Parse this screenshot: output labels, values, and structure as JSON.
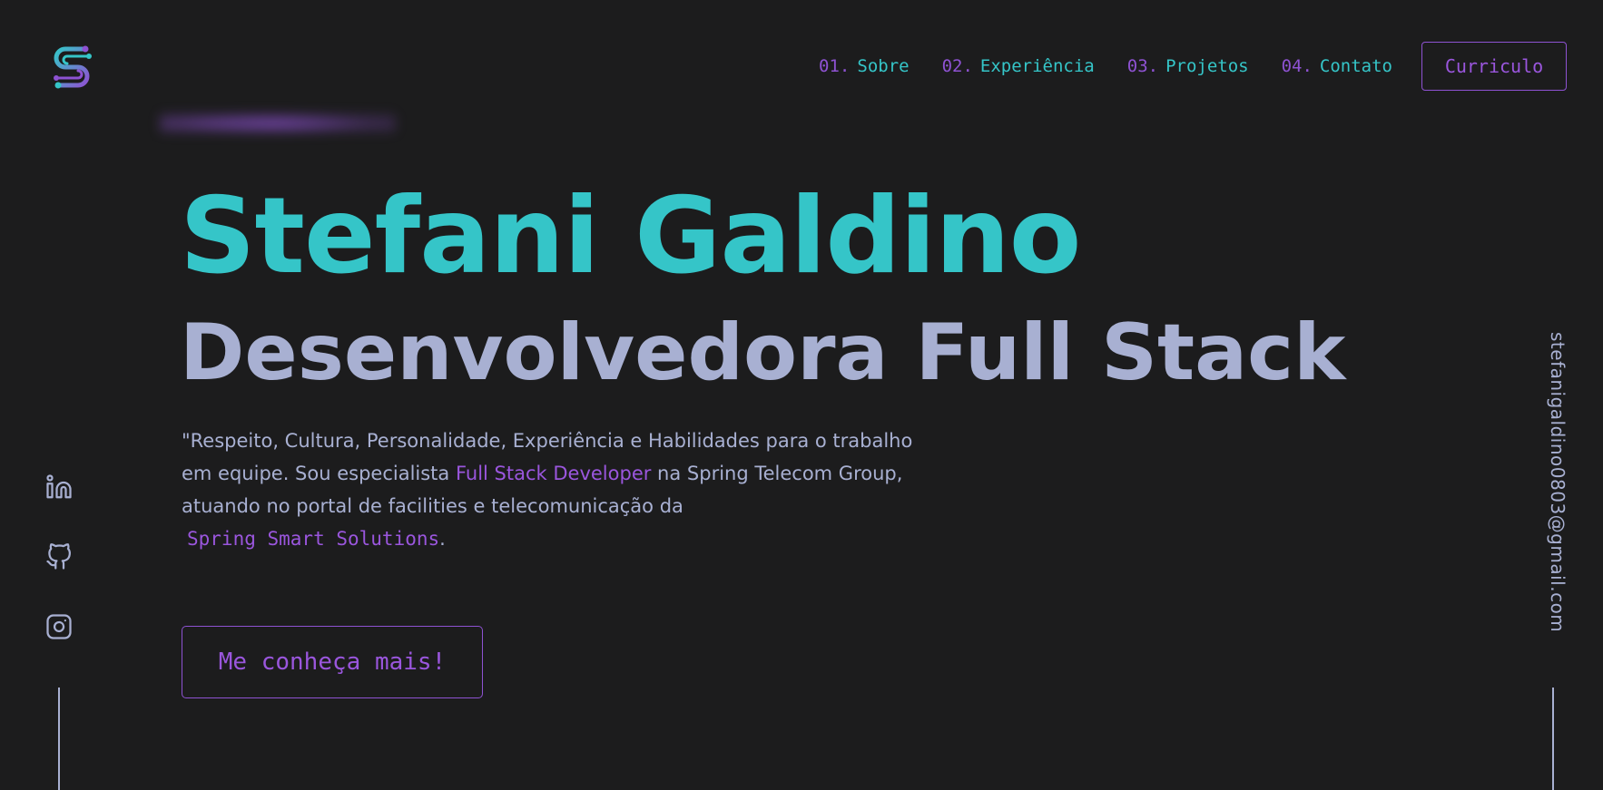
{
  "header": {
    "logo_icon": "s-circuit-logo-icon",
    "nav": [
      {
        "num": "01.",
        "label": "Sobre"
      },
      {
        "num": "02.",
        "label": "Experiência"
      },
      {
        "num": "03.",
        "label": "Projetos"
      },
      {
        "num": "04.",
        "label": "Contato"
      }
    ],
    "resume_label": "Curriculo"
  },
  "hero": {
    "name": "Stefani Galdino",
    "role": "Desenvolvedora Full Stack",
    "desc_part1": "\"Respeito, Cultura, Personalidade, Experiência e Habilidades para o trabalho em equipe. Sou especialista ",
    "desc_highlight": "Full Stack Developer",
    "desc_part2": " na Spring Telecom Group, atuando no portal de facilities e telecomunicação da",
    "desc_company": "Spring Smart Solutions",
    "desc_end": ".",
    "cta_label": "Me conheça mais!"
  },
  "social": {
    "icons": [
      "linkedin-icon",
      "github-icon",
      "instagram-icon"
    ]
  },
  "email": "stefanigaldino0803@gmail.com",
  "colors": {
    "background": "#1c1c1d",
    "accent_teal": "#35c5c8",
    "accent_purple": "#8e52d2",
    "text": "#a8b0d2"
  }
}
